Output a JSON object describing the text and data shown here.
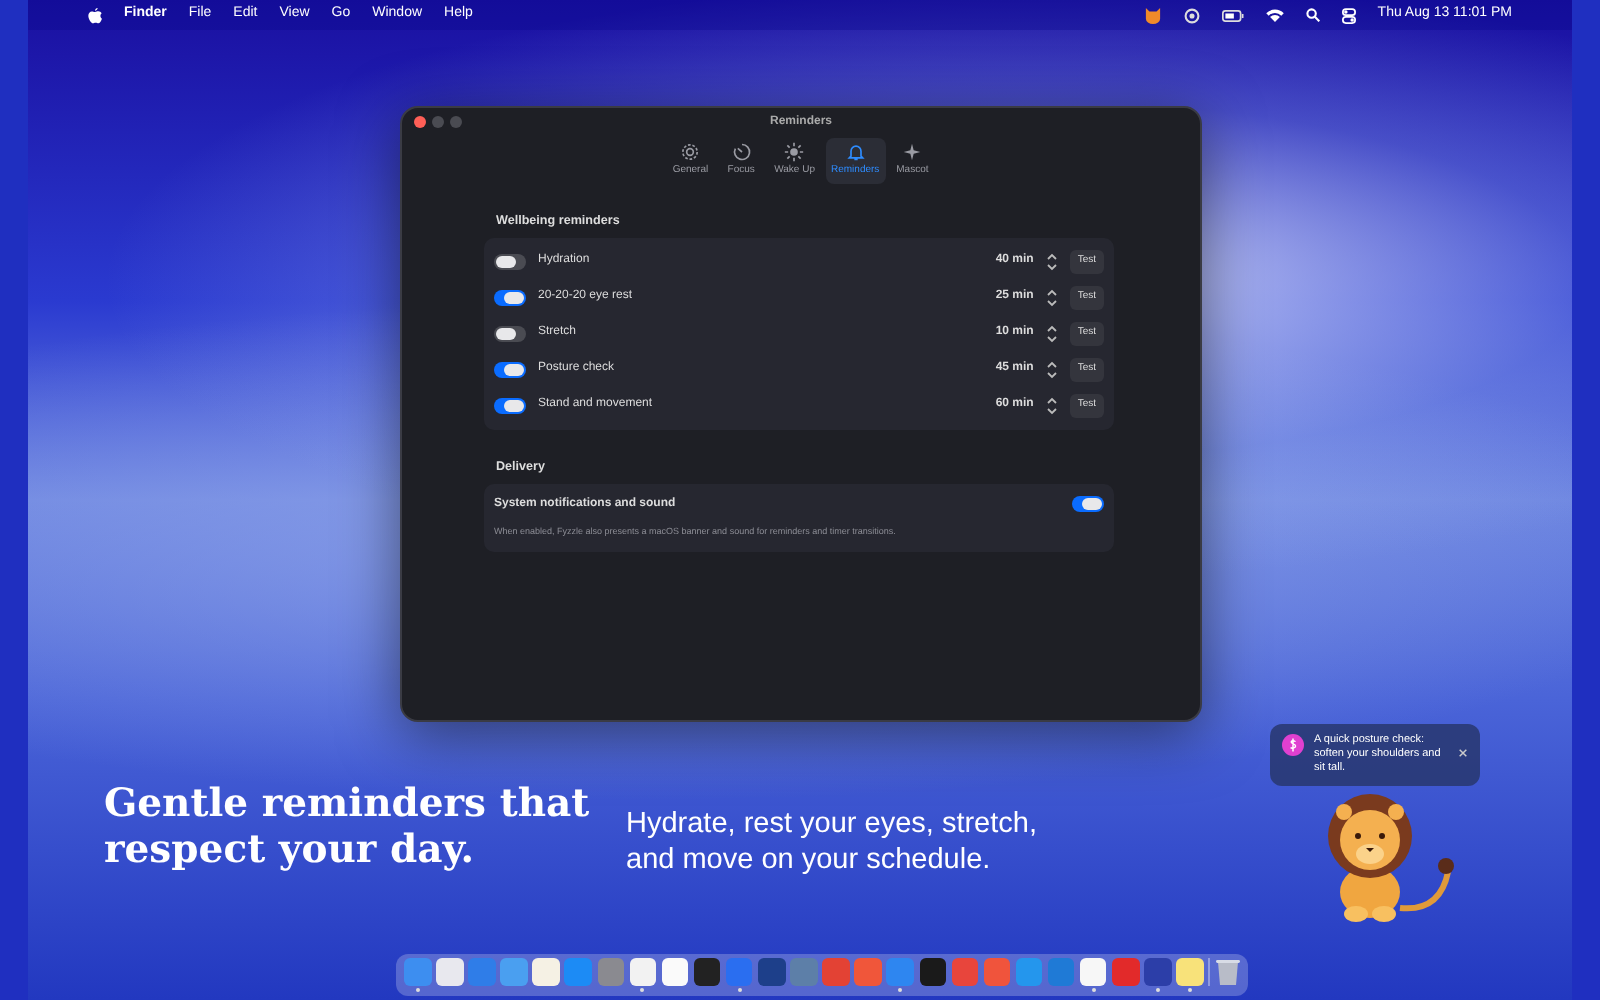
{
  "menu_bar": {
    "items": [
      "Finder",
      "File",
      "Edit",
      "View",
      "Go",
      "Window",
      "Help"
    ],
    "clock": "Thu Aug 13  11:01 PM"
  },
  "window": {
    "title": "Reminders",
    "tabs": [
      {
        "label": "General",
        "selected": false
      },
      {
        "label": "Focus",
        "selected": false
      },
      {
        "label": "Wake Up",
        "selected": false
      },
      {
        "label": "Reminders",
        "selected": true
      },
      {
        "label": "Mascot",
        "selected": false
      }
    ],
    "wellbeing": {
      "heading": "Wellbeing reminders",
      "rows": [
        {
          "label": "Hydration",
          "on": false,
          "interval": "40 min",
          "button": "Test"
        },
        {
          "label": "20-20-20 eye rest",
          "on": true,
          "interval": "25 min",
          "button": "Test"
        },
        {
          "label": "Stretch",
          "on": false,
          "interval": "10 min",
          "button": "Test"
        },
        {
          "label": "Posture check",
          "on": true,
          "interval": "45 min",
          "button": "Test"
        },
        {
          "label": "Stand and movement",
          "on": true,
          "interval": "60 min",
          "button": "Test"
        }
      ]
    },
    "delivery": {
      "heading": "Delivery",
      "label": "System notifications and sound",
      "on": true,
      "note": "When enabled, Fyzzle also presents a macOS banner and sound for reminders and timer transitions."
    }
  },
  "hero": {
    "headline": "Gentle reminders that respect your day.",
    "subtitle": "Hydrate, rest your eyes, stretch, and move on your schedule."
  },
  "mascot_bubble": {
    "text": "A quick posture check: soften your shoulders and sit tall."
  },
  "dock": {
    "apps": [
      {
        "color": "#3d8ef0",
        "running": true
      },
      {
        "color": "#e8e8ee",
        "running": false
      },
      {
        "color": "#2f7de8",
        "running": false
      },
      {
        "color": "#4a9ff0",
        "running": false
      },
      {
        "color": "#f5f1e4",
        "running": false
      },
      {
        "color": "#1c8bf5",
        "running": false
      },
      {
        "color": "#8a8a90",
        "running": false
      },
      {
        "color": "#f2f2f2",
        "running": true
      },
      {
        "color": "#fafafa",
        "running": false
      },
      {
        "color": "#222222",
        "running": false
      },
      {
        "color": "#2a6ef0",
        "running": true
      },
      {
        "color": "#1d3f8a",
        "running": false
      },
      {
        "color": "#5d7fa8",
        "running": false
      },
      {
        "color": "#e34234",
        "running": false
      },
      {
        "color": "#f0563a",
        "running": false
      },
      {
        "color": "#2e86f0",
        "running": true
      },
      {
        "color": "#1a1a1a",
        "running": false
      },
      {
        "color": "#e8453c",
        "running": false
      },
      {
        "color": "#f0543c",
        "running": false
      },
      {
        "color": "#2496ed",
        "running": false
      },
      {
        "color": "#1f7ad6",
        "running": false
      },
      {
        "color": "#f7f7f7",
        "running": true
      },
      {
        "color": "#e22a2a",
        "running": false
      },
      {
        "color": "#2c3ea8",
        "running": true
      },
      {
        "color": "#f8e27a",
        "running": true
      }
    ]
  }
}
